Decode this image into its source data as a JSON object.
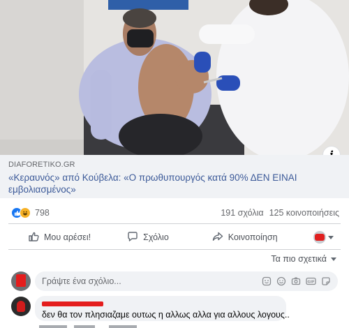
{
  "photo": {
    "alt_icon": "info-icon"
  },
  "link": {
    "source": "DIAFORETIKO.GR",
    "title": "«Κεραυνός» από Κούβελα: «Ο πρωθυπουργός κατά 90% ΔΕΝ ΕΙΝΑΙ εμβολιασμένος»"
  },
  "stats": {
    "reaction_count": "798",
    "comments": "191 σχόλια",
    "shares": "125 κοινοποιήσεις"
  },
  "actions": {
    "like": "Μου αρέσει!",
    "comment": "Σχόλιο",
    "share": "Κοινοποίηση"
  },
  "sort": {
    "label": "Τα πιο σχετικά"
  },
  "comment_input": {
    "placeholder": "Γράψτε ένα σχόλιο..."
  },
  "comments": [
    {
      "text": "δεν θα τον πλησιαζαμε ουτως η αλλως αλλα για αλλους λογους.."
    }
  ],
  "colors": {
    "link_title": "#3b5998",
    "like_blue": "#1877f2",
    "redaction": "#e41d1d"
  }
}
